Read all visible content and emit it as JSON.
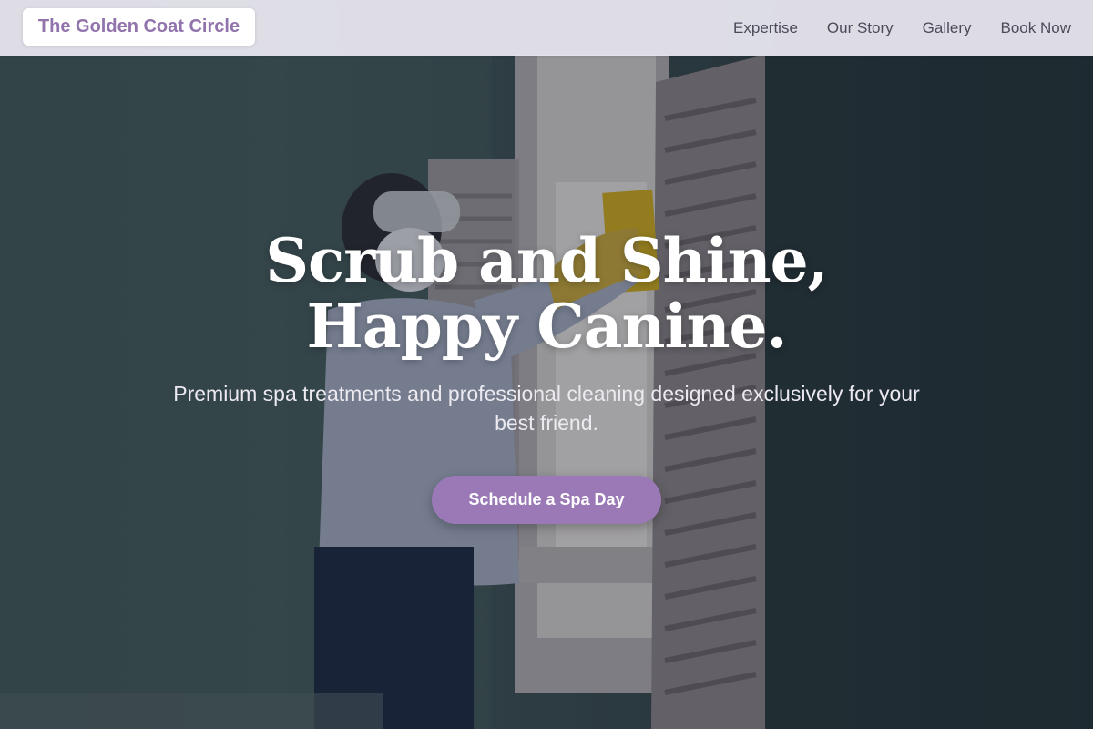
{
  "nav": {
    "brand": "The Golden Coat Circle",
    "links": [
      "Expertise",
      "Our Story",
      "Gallery",
      "Book Now"
    ]
  },
  "hero": {
    "headline_line1": "Scrub and Shine,",
    "headline_line2": "Happy Canine.",
    "subtitle": "Premium spa treatments and professional cleaning designed exclusively for your best friend.",
    "cta_label": "Schedule a Spa Day"
  },
  "colors": {
    "accent": "#9a79b6",
    "brand_text": "#9274ad",
    "nav_background": "#ece9f2"
  }
}
